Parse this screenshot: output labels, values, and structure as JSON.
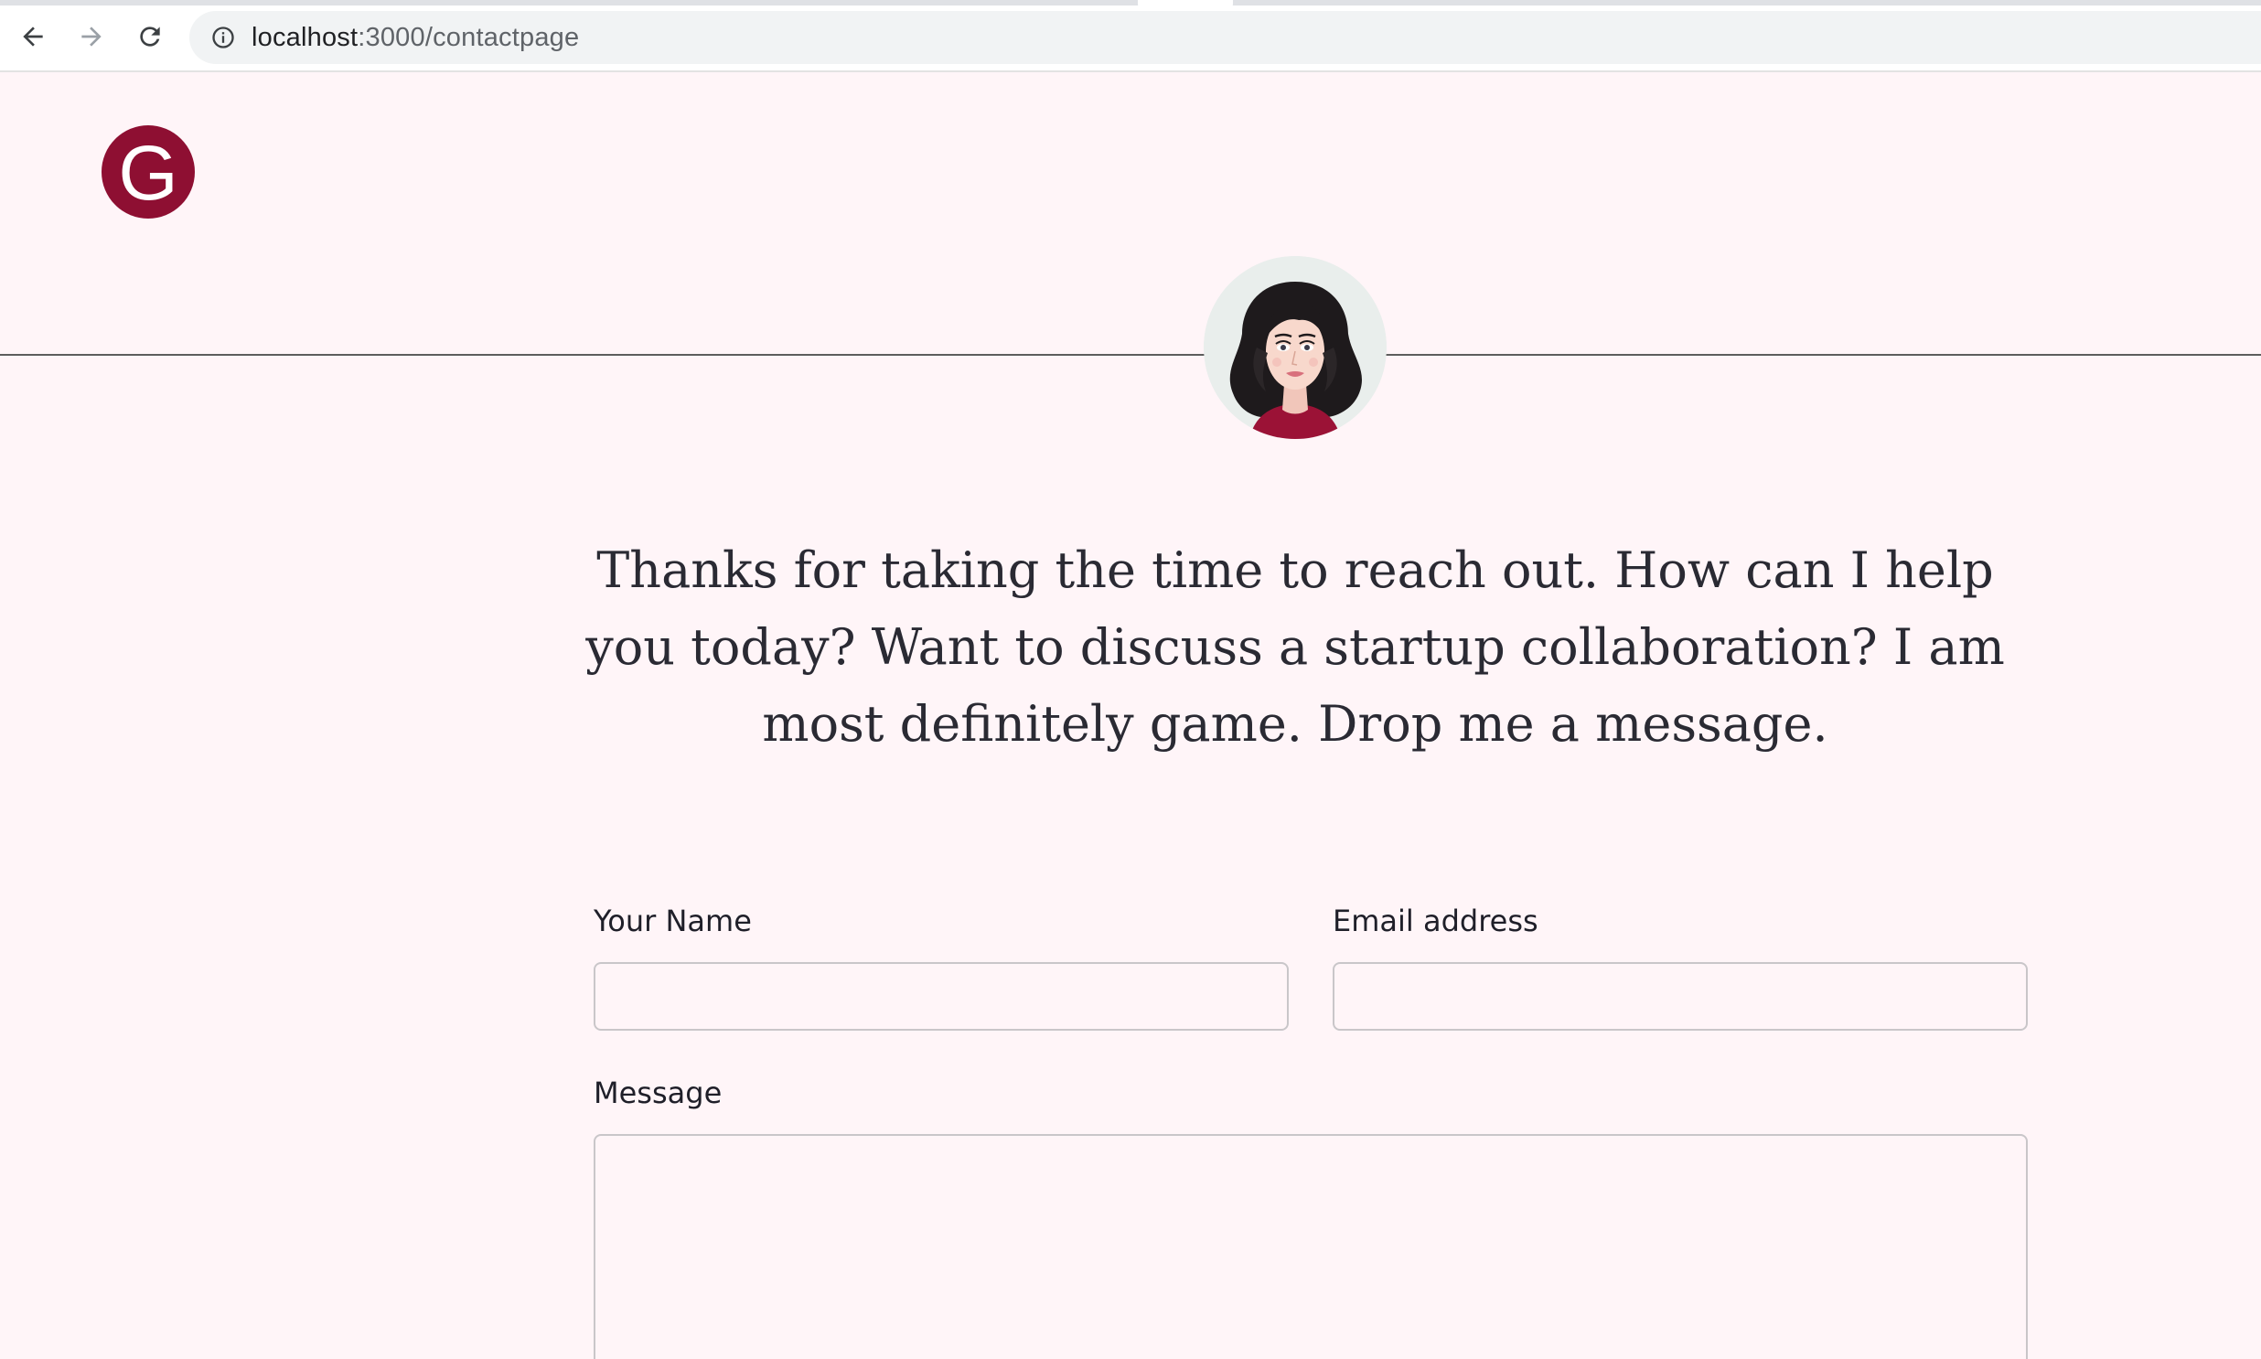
{
  "browser": {
    "url_host": "localhost",
    "url_path": ":3000/contactpage"
  },
  "header": {
    "logo_letter": "G"
  },
  "main": {
    "intro_text": "Thanks for taking the time to reach out. How can I help you today? Want to discuss a startup collaboration? I am most definitely game. Drop me a message."
  },
  "form": {
    "name_label": "Your Name",
    "name_value": "",
    "email_label": "Email address",
    "email_value": "",
    "message_label": "Message",
    "message_value": ""
  },
  "colors": {
    "page_background": "#fff5f8",
    "brand": "#8e0f32",
    "text": "#2a2a33"
  },
  "icons": {
    "back": "arrow-left-icon",
    "forward": "arrow-right-icon",
    "reload": "reload-icon",
    "site_info": "info-icon"
  }
}
